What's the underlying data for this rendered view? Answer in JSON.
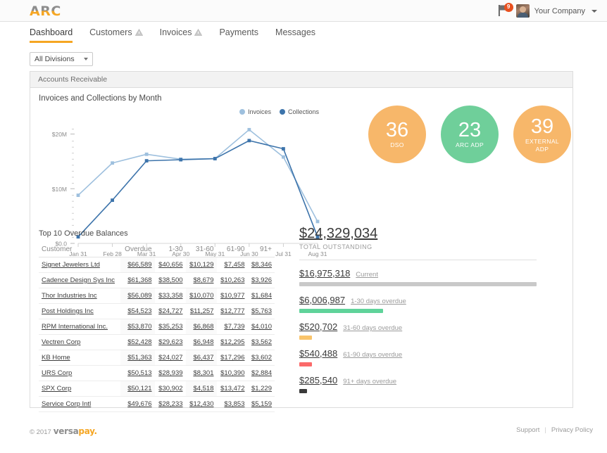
{
  "header": {
    "logo_text": "ARC",
    "flag_icon": "flag-icon",
    "notification_count": "9",
    "company_name": "Your Company"
  },
  "nav": {
    "items": [
      {
        "label": "Dashboard",
        "active": true,
        "warning": false
      },
      {
        "label": "Customers",
        "active": false,
        "warning": true
      },
      {
        "label": "Invoices",
        "active": false,
        "warning": true
      },
      {
        "label": "Payments",
        "active": false,
        "warning": false
      },
      {
        "label": "Messages",
        "active": false,
        "warning": false
      }
    ]
  },
  "filter": {
    "division_selected": "All Divisions"
  },
  "card": {
    "header_title": "Accounts Receivable",
    "chart_title": "Invoices and Collections by Month"
  },
  "metrics": [
    {
      "value": "36",
      "label": "DSO",
      "color": "#f7b76a"
    },
    {
      "value": "23",
      "label": "ARC ADP",
      "color": "#6fcf9a"
    },
    {
      "value": "39",
      "label": "EXTERNAL ADP",
      "color": "#f7b76a"
    }
  ],
  "table": {
    "title": "Top 10 Overdue Balances",
    "columns": [
      "Customer",
      "Overdue",
      "1-30",
      "31-60",
      "61-90",
      "91+"
    ],
    "rows": [
      [
        "Signet Jewelers Ltd",
        "$66,589",
        "$40,656",
        "$10,129",
        "$7,458",
        "$8,346"
      ],
      [
        "Cadence Design Sys Inc",
        "$61,368",
        "$38,500",
        "$8,679",
        "$10,263",
        "$3,926"
      ],
      [
        "Thor Industries Inc",
        "$56,089",
        "$33,358",
        "$10,070",
        "$10,977",
        "$1,684"
      ],
      [
        "Post Holdings Inc",
        "$54,523",
        "$24,727",
        "$11,257",
        "$12,777",
        "$5,763"
      ],
      [
        "RPM International Inc.",
        "$53,870",
        "$35,253",
        "$6,868",
        "$7,739",
        "$4,010"
      ],
      [
        "Vectren Corp",
        "$52,428",
        "$29,623",
        "$6,948",
        "$12,295",
        "$3,562"
      ],
      [
        "KB Home",
        "$51,363",
        "$24,027",
        "$6,437",
        "$17,296",
        "$3,602"
      ],
      [
        "URS Corp",
        "$50,513",
        "$28,939",
        "$8,301",
        "$10,390",
        "$2,884"
      ],
      [
        "SPX Corp",
        "$50,121",
        "$30,902",
        "$4,518",
        "$13,472",
        "$1,229"
      ],
      [
        "Service Corp Intl",
        "$49,676",
        "$28,233",
        "$12,430",
        "$3,853",
        "$5,159"
      ]
    ]
  },
  "outstanding": {
    "total_amount": "$24,329,034",
    "total_label": "TOTAL OUTSTANDING",
    "buckets": [
      {
        "amount": "$16,975,318",
        "label": "Current",
        "color": "#c9c9c9",
        "pct": 100
      },
      {
        "amount": "$6,006,987",
        "label": "1-30 days overdue",
        "color": "#5fd39a",
        "pct": 35.4
      },
      {
        "amount": "$520,702",
        "label": "31-60 days overdue",
        "color": "#f9c46b",
        "pct": 5.3
      },
      {
        "amount": "$540,488",
        "label": "61-90 days overdue",
        "color": "#fb6a6a",
        "pct": 5.4
      },
      {
        "amount": "$285,540",
        "label": "91+ days overdue",
        "color": "#3a3a3a",
        "pct": 3.2
      }
    ]
  },
  "footer": {
    "copyright": "© 2017",
    "brand_part1": "versa",
    "brand_part2": "pay.",
    "support_link": "Support",
    "separator": "|",
    "privacy_link": "Privacy Policy"
  },
  "chart_data": {
    "type": "line",
    "title": "Invoices and Collections by Month",
    "xlabel": "",
    "ylabel": "",
    "categories": [
      "Jan 31",
      "Feb 28",
      "Mar 31",
      "Apr 30",
      "May 31",
      "Jun 30",
      "Jul 31",
      "Aug 31"
    ],
    "ylim": [
      0,
      22
    ],
    "yticks": [
      0,
      10,
      20
    ],
    "ytick_labels": [
      "$0.0",
      "$10M",
      "$20M"
    ],
    "grid": false,
    "legend_position": "top-right",
    "series": [
      {
        "name": "Invoices",
        "color": "#9ec0de",
        "values": [
          8.8,
          14.7,
          16.3,
          15.4,
          15.5,
          20.8,
          15.8,
          4.0
        ]
      },
      {
        "name": "Collections",
        "color": "#3d74ab",
        "values": [
          1.2,
          7.9,
          15.1,
          15.3,
          15.5,
          18.8,
          17.3,
          1.2
        ]
      }
    ]
  }
}
